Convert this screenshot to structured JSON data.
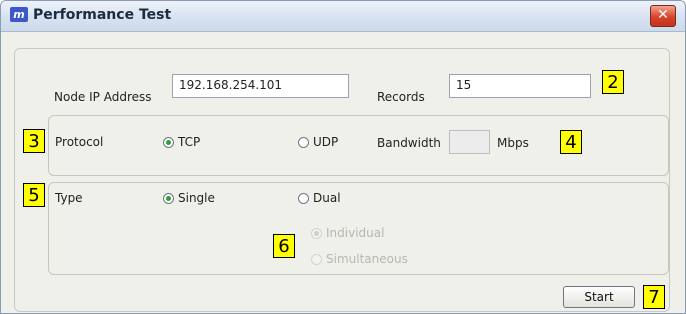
{
  "window": {
    "title": "Performance Test",
    "icon_text": "m",
    "close_label": "✕"
  },
  "fields": {
    "node_ip_label": "Node IP Address",
    "node_ip_value": "192.168.254.101",
    "records_label": "Records",
    "records_value": "15"
  },
  "protocol": {
    "label": "Protocol",
    "options": [
      "TCP",
      "UDP"
    ],
    "selected": "TCP",
    "bandwidth_label": "Bandwidth",
    "bandwidth_value": "",
    "bandwidth_unit": "Mbps"
  },
  "type": {
    "label": "Type",
    "options": [
      "Single",
      "Dual"
    ],
    "selected": "Single",
    "sub_options": [
      "Individual",
      "Simultaneous"
    ],
    "sub_selected": "Individual"
  },
  "start_label": "Start",
  "callouts": [
    "2",
    "3",
    "4",
    "5",
    "6",
    "7"
  ],
  "colors": {
    "callout_bg": "#ffff00",
    "radio_checked": "#2c9f3d"
  }
}
